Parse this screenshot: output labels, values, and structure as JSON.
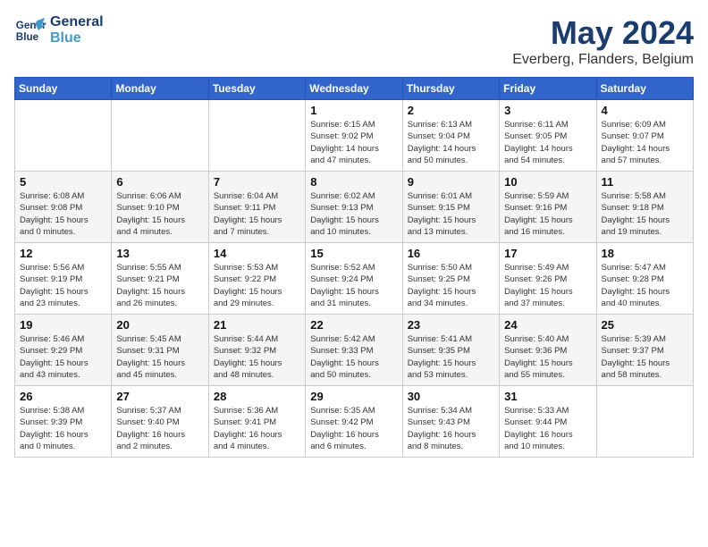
{
  "header": {
    "logo_line1": "General",
    "logo_line2": "Blue",
    "month": "May 2024",
    "location": "Everberg, Flanders, Belgium"
  },
  "days_of_week": [
    "Sunday",
    "Monday",
    "Tuesday",
    "Wednesday",
    "Thursday",
    "Friday",
    "Saturday"
  ],
  "weeks": [
    [
      {
        "day": "",
        "info": ""
      },
      {
        "day": "",
        "info": ""
      },
      {
        "day": "",
        "info": ""
      },
      {
        "day": "1",
        "info": "Sunrise: 6:15 AM\nSunset: 9:02 PM\nDaylight: 14 hours\nand 47 minutes."
      },
      {
        "day": "2",
        "info": "Sunrise: 6:13 AM\nSunset: 9:04 PM\nDaylight: 14 hours\nand 50 minutes."
      },
      {
        "day": "3",
        "info": "Sunrise: 6:11 AM\nSunset: 9:05 PM\nDaylight: 14 hours\nand 54 minutes."
      },
      {
        "day": "4",
        "info": "Sunrise: 6:09 AM\nSunset: 9:07 PM\nDaylight: 14 hours\nand 57 minutes."
      }
    ],
    [
      {
        "day": "5",
        "info": "Sunrise: 6:08 AM\nSunset: 9:08 PM\nDaylight: 15 hours\nand 0 minutes."
      },
      {
        "day": "6",
        "info": "Sunrise: 6:06 AM\nSunset: 9:10 PM\nDaylight: 15 hours\nand 4 minutes."
      },
      {
        "day": "7",
        "info": "Sunrise: 6:04 AM\nSunset: 9:11 PM\nDaylight: 15 hours\nand 7 minutes."
      },
      {
        "day": "8",
        "info": "Sunrise: 6:02 AM\nSunset: 9:13 PM\nDaylight: 15 hours\nand 10 minutes."
      },
      {
        "day": "9",
        "info": "Sunrise: 6:01 AM\nSunset: 9:15 PM\nDaylight: 15 hours\nand 13 minutes."
      },
      {
        "day": "10",
        "info": "Sunrise: 5:59 AM\nSunset: 9:16 PM\nDaylight: 15 hours\nand 16 minutes."
      },
      {
        "day": "11",
        "info": "Sunrise: 5:58 AM\nSunset: 9:18 PM\nDaylight: 15 hours\nand 19 minutes."
      }
    ],
    [
      {
        "day": "12",
        "info": "Sunrise: 5:56 AM\nSunset: 9:19 PM\nDaylight: 15 hours\nand 23 minutes."
      },
      {
        "day": "13",
        "info": "Sunrise: 5:55 AM\nSunset: 9:21 PM\nDaylight: 15 hours\nand 26 minutes."
      },
      {
        "day": "14",
        "info": "Sunrise: 5:53 AM\nSunset: 9:22 PM\nDaylight: 15 hours\nand 29 minutes."
      },
      {
        "day": "15",
        "info": "Sunrise: 5:52 AM\nSunset: 9:24 PM\nDaylight: 15 hours\nand 31 minutes."
      },
      {
        "day": "16",
        "info": "Sunrise: 5:50 AM\nSunset: 9:25 PM\nDaylight: 15 hours\nand 34 minutes."
      },
      {
        "day": "17",
        "info": "Sunrise: 5:49 AM\nSunset: 9:26 PM\nDaylight: 15 hours\nand 37 minutes."
      },
      {
        "day": "18",
        "info": "Sunrise: 5:47 AM\nSunset: 9:28 PM\nDaylight: 15 hours\nand 40 minutes."
      }
    ],
    [
      {
        "day": "19",
        "info": "Sunrise: 5:46 AM\nSunset: 9:29 PM\nDaylight: 15 hours\nand 43 minutes."
      },
      {
        "day": "20",
        "info": "Sunrise: 5:45 AM\nSunset: 9:31 PM\nDaylight: 15 hours\nand 45 minutes."
      },
      {
        "day": "21",
        "info": "Sunrise: 5:44 AM\nSunset: 9:32 PM\nDaylight: 15 hours\nand 48 minutes."
      },
      {
        "day": "22",
        "info": "Sunrise: 5:42 AM\nSunset: 9:33 PM\nDaylight: 15 hours\nand 50 minutes."
      },
      {
        "day": "23",
        "info": "Sunrise: 5:41 AM\nSunset: 9:35 PM\nDaylight: 15 hours\nand 53 minutes."
      },
      {
        "day": "24",
        "info": "Sunrise: 5:40 AM\nSunset: 9:36 PM\nDaylight: 15 hours\nand 55 minutes."
      },
      {
        "day": "25",
        "info": "Sunrise: 5:39 AM\nSunset: 9:37 PM\nDaylight: 15 hours\nand 58 minutes."
      }
    ],
    [
      {
        "day": "26",
        "info": "Sunrise: 5:38 AM\nSunset: 9:39 PM\nDaylight: 16 hours\nand 0 minutes."
      },
      {
        "day": "27",
        "info": "Sunrise: 5:37 AM\nSunset: 9:40 PM\nDaylight: 16 hours\nand 2 minutes."
      },
      {
        "day": "28",
        "info": "Sunrise: 5:36 AM\nSunset: 9:41 PM\nDaylight: 16 hours\nand 4 minutes."
      },
      {
        "day": "29",
        "info": "Sunrise: 5:35 AM\nSunset: 9:42 PM\nDaylight: 16 hours\nand 6 minutes."
      },
      {
        "day": "30",
        "info": "Sunrise: 5:34 AM\nSunset: 9:43 PM\nDaylight: 16 hours\nand 8 minutes."
      },
      {
        "day": "31",
        "info": "Sunrise: 5:33 AM\nSunset: 9:44 PM\nDaylight: 16 hours\nand 10 minutes."
      },
      {
        "day": "",
        "info": ""
      }
    ]
  ]
}
